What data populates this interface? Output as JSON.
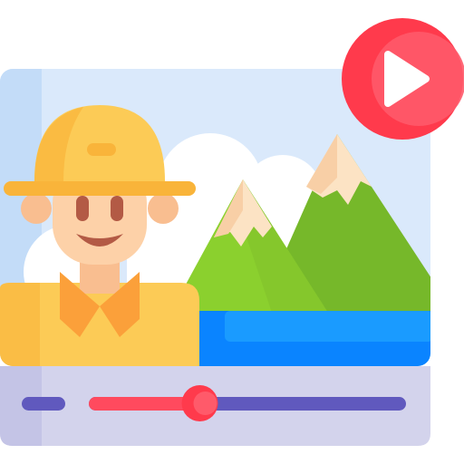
{
  "icon": {
    "subject": "ranger-travel-video-icon",
    "colors": {
      "sky": "#DAE9FB",
      "sky_edge": "#C3DCF8",
      "cloud": "#FFFFFF",
      "mountain_light": "#8BD02E",
      "mountain_dark": "#76B82A",
      "snow": "#FCE3C4",
      "snow_shade": "#F8CFA6",
      "water": "#0A84FF",
      "water_light": "#1A9BFF",
      "hat": "#FCCB56",
      "hat_shade": "#F9B43A",
      "skin": "#FDD1A8",
      "skin_shade": "#F9BE90",
      "shirt": "#FCCB56",
      "collar": "#FBA03A",
      "control_bar": "#D3D3EC",
      "control_bar_shade": "#C4C4E6",
      "track": "#6059BE",
      "progress": "#FF4A5E",
      "knob": "#FF3A4C",
      "play_outer": "#FF3A4C",
      "play_inner": "#FF5A6A",
      "play_glyph": "#FFFFFF"
    },
    "player": {
      "playing": false,
      "progress_fraction": 0.35
    }
  }
}
